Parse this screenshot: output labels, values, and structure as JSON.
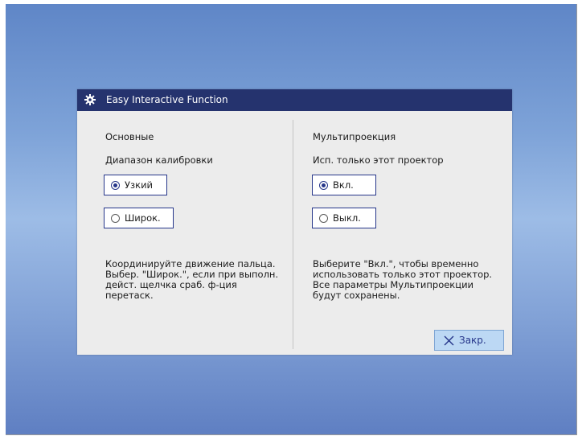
{
  "dialog": {
    "title": "Easy Interactive Function",
    "icon": "gear-icon"
  },
  "left": {
    "section": "Основные",
    "setting": "Диапазон калибровки",
    "options": [
      {
        "label": "Узкий",
        "selected": true
      },
      {
        "label": "Широк.",
        "selected": false
      }
    ],
    "description": "Координируйте движение пальца.\nВыбер. \"Широк.\", если при выполн.\nдейст. щелчка сраб. ф-ция\nперетаск."
  },
  "right": {
    "section": "Мультипроекция",
    "setting": "Исп. только этот проектор",
    "options": [
      {
        "label": "Вкл.",
        "selected": true
      },
      {
        "label": "Выкл.",
        "selected": false
      }
    ],
    "description": "Выберите \"Вкл.\", чтобы временно\nиспользовать только этот проектор.\nВсе параметры Мультипроекции\nбудут сохранены."
  },
  "close_button": {
    "label": "Закр.",
    "icon": "close-icon"
  },
  "colors": {
    "titlebar": "#25336e",
    "accent": "#26368a",
    "dialog_bg": "#ececec",
    "close_bg": "#bcd8f4"
  }
}
